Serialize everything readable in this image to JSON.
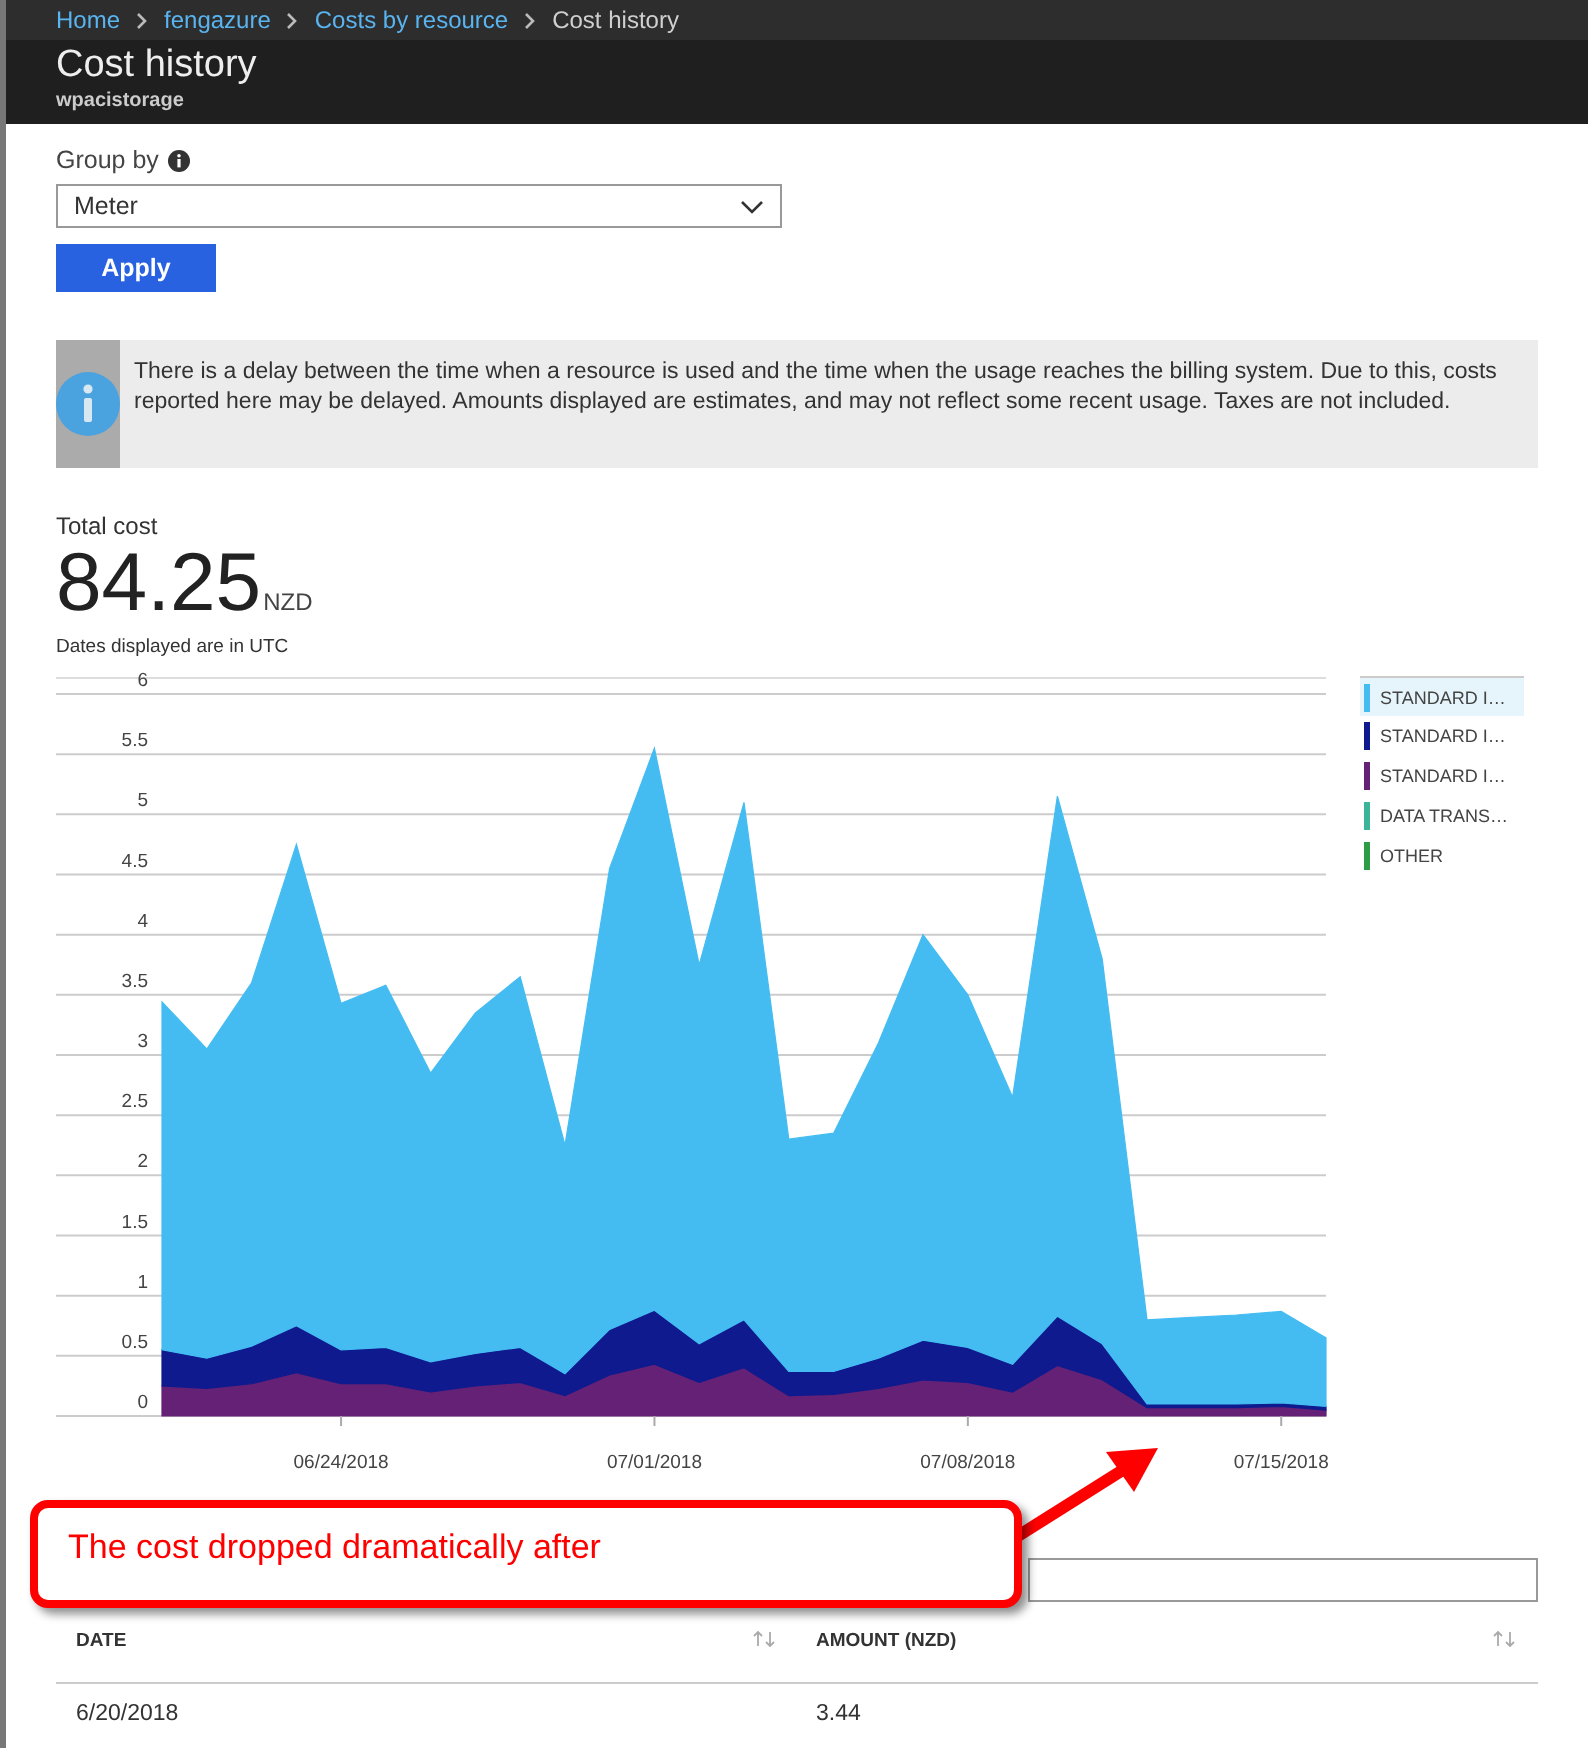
{
  "breadcrumb": [
    {
      "label": "Home",
      "current": false
    },
    {
      "label": "fengazure",
      "current": false
    },
    {
      "label": "Costs by resource",
      "current": false
    },
    {
      "label": "Cost history",
      "current": true
    }
  ],
  "header": {
    "title": "Cost history",
    "subtitle": "wpacistorage"
  },
  "group_by": {
    "label": "Group by",
    "value": "Meter"
  },
  "apply_button": "Apply",
  "notice": "There is a delay between the time when a resource is used and the time when the usage reaches the billing system. Due to this, costs reported here may be delayed. Amounts displayed are estimates, and may not reflect some recent usage. Taxes are not included.",
  "total": {
    "label": "Total cost",
    "value": "84.25",
    "unit": "NZD"
  },
  "dates_note": "Dates displayed are in UTC",
  "chart_data": {
    "type": "area",
    "stacked": true,
    "grid": true,
    "categories": [
      null,
      null,
      null,
      null,
      "06/24/2018",
      null,
      null,
      null,
      null,
      null,
      null,
      "07/01/2018",
      null,
      null,
      null,
      null,
      null,
      null,
      "07/08/2018",
      null,
      null,
      null,
      null,
      null,
      null,
      "07/15/2018",
      null
    ],
    "ylim": [
      0,
      6
    ],
    "yticks": [
      0,
      0.5,
      1,
      1.5,
      2,
      2.5,
      3,
      3.5,
      4,
      4.5,
      5,
      5.5,
      6
    ],
    "series": [
      {
        "name": "OTHER",
        "color": "#2e9c44",
        "values": [
          null,
          null,
          null,
          null,
          null,
          null,
          null,
          null,
          null,
          null,
          null,
          null,
          null,
          null,
          null,
          null,
          null,
          null,
          null,
          null,
          null,
          null,
          null,
          null,
          null,
          null,
          null
        ]
      },
      {
        "name": "DATA TRANS…",
        "color": "#3bb49a",
        "values": [
          null,
          null,
          null,
          null,
          null,
          null,
          null,
          null,
          null,
          null,
          null,
          null,
          null,
          null,
          null,
          null,
          null,
          null,
          null,
          null,
          null,
          null,
          null,
          null,
          null,
          null,
          null
        ]
      },
      {
        "name": "STANDARD I…",
        "color": "#642175",
        "values": [
          0.25,
          0.23,
          0.27,
          0.36,
          0.27,
          0.27,
          0.2,
          0.25,
          0.28,
          0.17,
          0.34,
          0.43,
          0.28,
          0.4,
          0.17,
          0.18,
          0.23,
          0.3,
          0.28,
          0.2,
          0.42,
          0.3,
          0.07,
          0.07,
          0.07,
          0.08,
          0.05
        ]
      },
      {
        "name": "STANDARD I…",
        "color": "#0e1a8e",
        "values": [
          0.3,
          0.25,
          0.31,
          0.39,
          0.28,
          0.3,
          0.25,
          0.27,
          0.29,
          0.18,
          0.38,
          0.45,
          0.32,
          0.4,
          0.2,
          0.19,
          0.25,
          0.33,
          0.29,
          0.23,
          0.41,
          0.3,
          0.03,
          0.03,
          0.03,
          0.03,
          0.03
        ]
      },
      {
        "name": "STANDARD I…",
        "color": "#44bcf2",
        "values": [
          2.89,
          2.57,
          3.02,
          4.0,
          2.88,
          3.01,
          2.4,
          2.83,
          3.08,
          1.9,
          3.83,
          4.67,
          3.15,
          4.3,
          1.93,
          1.98,
          2.62,
          3.37,
          2.93,
          2.22,
          4.32,
          3.2,
          0.7,
          0.72,
          0.74,
          0.76,
          0.57
        ]
      }
    ]
  },
  "legend": [
    {
      "selected": true
    },
    {
      "selected": false
    },
    {
      "selected": false
    },
    {
      "selected": false
    },
    {
      "selected": false
    }
  ],
  "table": {
    "columns": [
      "DATE",
      "AMOUNT (NZD)"
    ],
    "rows": [
      [
        "6/20/2018",
        "3.44"
      ]
    ]
  },
  "callout": {
    "text": "The cost dropped dramatically after"
  }
}
